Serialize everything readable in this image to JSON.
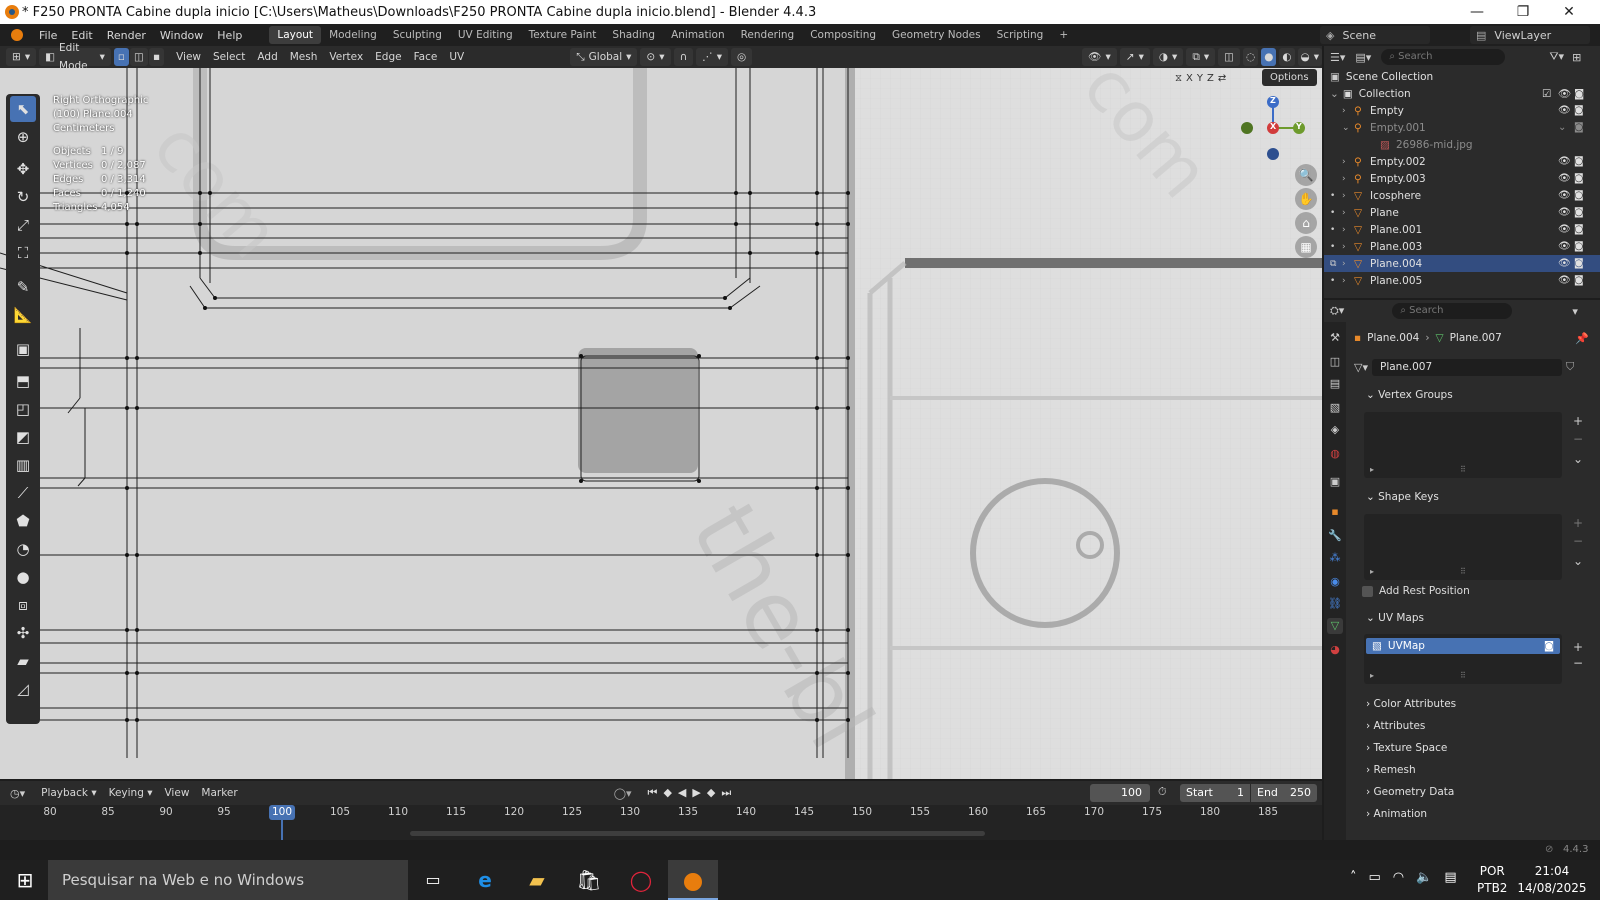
{
  "window": {
    "title": "* F250 PRONTA Cabine dupla inicio [C:\\Users\\Matheus\\Downloads\\F250 PRONTA Cabine dupla inicio.blend] - Blender 4.4.3",
    "minimize": "—",
    "restore": "❐",
    "close": "✕"
  },
  "menu": {
    "items": [
      "File",
      "Edit",
      "Render",
      "Window",
      "Help"
    ],
    "workspaces": [
      "Layout",
      "Modeling",
      "Sculpting",
      "UV Editing",
      "Texture Paint",
      "Shading",
      "Animation",
      "Rendering",
      "Compositing",
      "Geometry Nodes",
      "Scripting"
    ],
    "active_workspace": "Layout",
    "add_workspace": "+",
    "scene_label": "Scene",
    "view_layer_label": "ViewLayer"
  },
  "viewport_header": {
    "mode": "Edit Mode",
    "menus": [
      "View",
      "Select",
      "Add",
      "Mesh",
      "Vertex",
      "Edge",
      "Face",
      "UV"
    ],
    "orientation": "Global",
    "options": "Options",
    "axes": [
      "X",
      "Y",
      "Z"
    ]
  },
  "viewport_info": {
    "view_name": "Right Orthographic",
    "object": "(100) Plane.004",
    "units": "Centimeters",
    "stats": [
      {
        "label": "Objects",
        "value": "1 / 9"
      },
      {
        "label": "Vertices",
        "value": "0 / 2,087"
      },
      {
        "label": "Edges",
        "value": "0 / 3,314"
      },
      {
        "label": "Faces",
        "value": "0 / 1,240"
      },
      {
        "label": "Triangles",
        "value": "4,054"
      }
    ]
  },
  "gizmo": {
    "x": "X",
    "y": "Y",
    "z": "Z"
  },
  "outliner": {
    "search_placeholder": "Search",
    "scene_collection": "Scene Collection",
    "collection": "Collection",
    "items": [
      {
        "name": "Empty",
        "selected": false,
        "dim": false
      },
      {
        "name": "Empty.001",
        "selected": false,
        "dim": true
      },
      {
        "name": "26986-mid.jpg",
        "selected": false,
        "dim": true
      },
      {
        "name": "Empty.002",
        "selected": false,
        "dim": false
      },
      {
        "name": "Empty.003",
        "selected": false,
        "dim": false
      },
      {
        "name": "Icosphere",
        "selected": false,
        "dim": false
      },
      {
        "name": "Plane",
        "selected": false,
        "dim": false
      },
      {
        "name": "Plane.001",
        "selected": false,
        "dim": false
      },
      {
        "name": "Plane.003",
        "selected": false,
        "dim": false
      },
      {
        "name": "Plane.004",
        "selected": true,
        "dim": false
      },
      {
        "name": "Plane.005",
        "selected": false,
        "dim": false
      }
    ]
  },
  "properties": {
    "search_placeholder": "Search",
    "breadcrumb_object": "Plane.004",
    "breadcrumb_mesh": "Plane.007",
    "mesh_name": "Plane.007",
    "vertex_groups": "Vertex Groups",
    "shape_keys": "Shape Keys",
    "add_rest_position": "Add Rest Position",
    "uv_maps": "UV Maps",
    "uv_map_item": "UVMap",
    "collapsed_panels": [
      "Color Attributes",
      "Attributes",
      "Texture Space",
      "Remesh",
      "Geometry Data",
      "Animation"
    ]
  },
  "timeline": {
    "menus": [
      "Playback",
      "Keying",
      "View",
      "Marker"
    ],
    "current_frame": "100",
    "start_label": "Start",
    "start": "1",
    "end_label": "End",
    "end": "250",
    "ticks": [
      "80",
      "85",
      "90",
      "95",
      "100",
      "105",
      "110",
      "115",
      "120",
      "125",
      "130",
      "135",
      "140",
      "145",
      "150",
      "155",
      "160",
      "165",
      "170",
      "175",
      "180",
      "185"
    ],
    "playhead_frame": 100
  },
  "status": {
    "version": "4.4.3"
  },
  "taskbar": {
    "search_placeholder": "Pesquisar na Web e no Windows",
    "language": "POR",
    "layout": "PTB2",
    "time": "21:04",
    "date": "14/08/2025"
  },
  "colors": {
    "accent": "#4772b3",
    "selected_row": "#334d80",
    "blender_orange": "#e87d0d"
  }
}
